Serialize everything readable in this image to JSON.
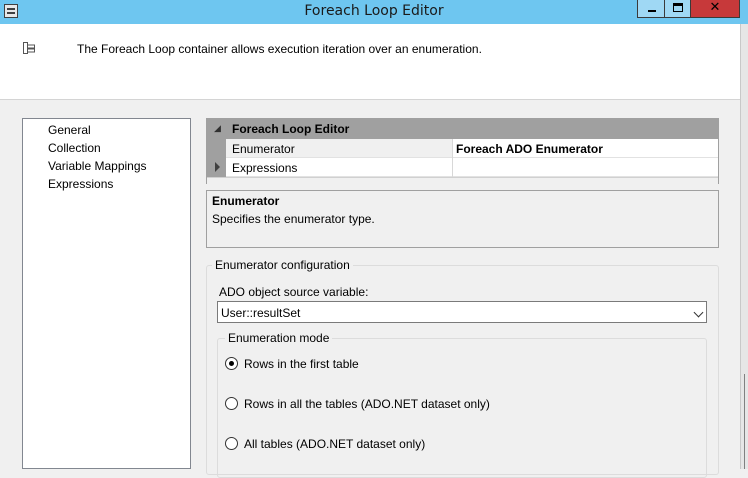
{
  "window": {
    "title": "Foreach Loop Editor",
    "close_glyph": "✕"
  },
  "header": {
    "description": "The Foreach Loop container allows execution iteration over an enumeration."
  },
  "nav": {
    "items": [
      {
        "label": "General"
      },
      {
        "label": "Collection",
        "selected": true
      },
      {
        "label": "Variable Mappings"
      },
      {
        "label": "Expressions"
      }
    ]
  },
  "property_grid": {
    "category": "Foreach Loop Editor",
    "rows": [
      {
        "name": "Enumerator",
        "value": "Foreach ADO Enumerator"
      },
      {
        "name": "Expressions",
        "value": ""
      }
    ]
  },
  "description_panel": {
    "title": "Enumerator",
    "text": "Specifies the enumerator type."
  },
  "enumerator_config": {
    "group_title": "Enumerator configuration",
    "source_label": "ADO object source variable:",
    "source_value": "User::resultSet",
    "mode_title": "Enumeration mode",
    "options": [
      {
        "label": "Rows in the first table",
        "checked": true
      },
      {
        "label": "Rows in all the tables (ADO.NET dataset only)",
        "checked": false
      },
      {
        "label": "All tables (ADO.NET dataset only)",
        "checked": false
      }
    ]
  },
  "colors": {
    "titlebar": "#6ec6f0",
    "close_button": "#c7393a",
    "grid_category": "#a0a0a0"
  }
}
